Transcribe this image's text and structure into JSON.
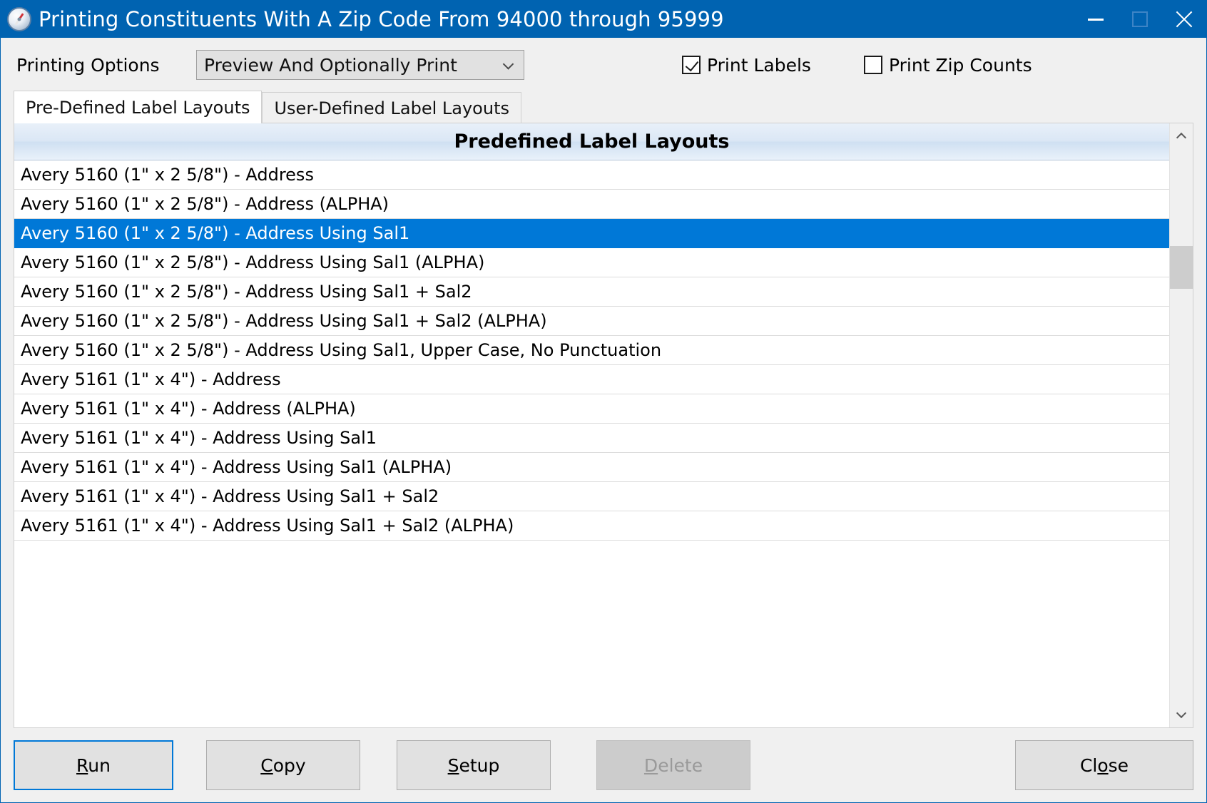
{
  "window": {
    "title": "Printing Constituents With A Zip Code From 94000 through 95999",
    "icon": "compass-icon",
    "accent_color": "#0063b1",
    "controls": {
      "minimize": "minimize-icon",
      "maximize": "maximize-icon",
      "close": "close-icon"
    }
  },
  "options": {
    "printing_options_label": "Printing Options",
    "printing_options_value": "Preview And Optionally Print",
    "print_labels": {
      "label": "Print Labels",
      "checked": true
    },
    "print_zip_counts": {
      "label": "Print Zip Counts",
      "checked": false
    }
  },
  "tabs": [
    {
      "label": "Pre-Defined Label Layouts",
      "active": true
    },
    {
      "label": "User-Defined Label Layouts",
      "active": false
    }
  ],
  "list": {
    "header": "Predefined Label Layouts",
    "selected_index": 2,
    "selection_color": "#0078d7",
    "rows": [
      "Avery 5160 (1\" x 2 5/8\") - Address",
      "Avery 5160 (1\" x 2 5/8\") - Address (ALPHA)",
      "Avery 5160 (1\" x 2 5/8\") - Address Using Sal1",
      "Avery 5160 (1\" x 2 5/8\") - Address Using Sal1 (ALPHA)",
      "Avery 5160 (1\" x 2 5/8\") - Address Using Sal1 + Sal2",
      "Avery 5160 (1\" x 2 5/8\") - Address Using Sal1 + Sal2 (ALPHA)",
      "Avery 5160 (1\" x 2 5/8\") - Address Using Sal1, Upper Case, No Punctuation",
      "Avery 5161 (1\" x 4\") - Address",
      "Avery 5161 (1\" x 4\") - Address (ALPHA)",
      "Avery 5161 (1\" x 4\") - Address Using Sal1",
      "Avery 5161 (1\" x 4\") - Address Using Sal1 (ALPHA)",
      "Avery 5161 (1\" x 4\") - Address Using Sal1 + Sal2",
      "Avery 5161 (1\" x 4\") - Address Using Sal1 + Sal2 (ALPHA)"
    ]
  },
  "scrollbar": {
    "up_icon": "chevron-up-icon",
    "down_icon": "chevron-down-icon"
  },
  "footer": {
    "run": {
      "accel": "R",
      "rest": "un",
      "disabled": false,
      "focused": true
    },
    "copy": {
      "accel": "C",
      "rest": "opy",
      "disabled": false,
      "focused": false
    },
    "setup": {
      "accel": "S",
      "rest": "etup",
      "disabled": false,
      "focused": false
    },
    "delete": {
      "accel": "D",
      "rest": "elete",
      "disabled": true,
      "focused": false
    },
    "close": {
      "pre": "Cl",
      "accel": "o",
      "rest": "se",
      "disabled": false,
      "focused": false
    }
  }
}
